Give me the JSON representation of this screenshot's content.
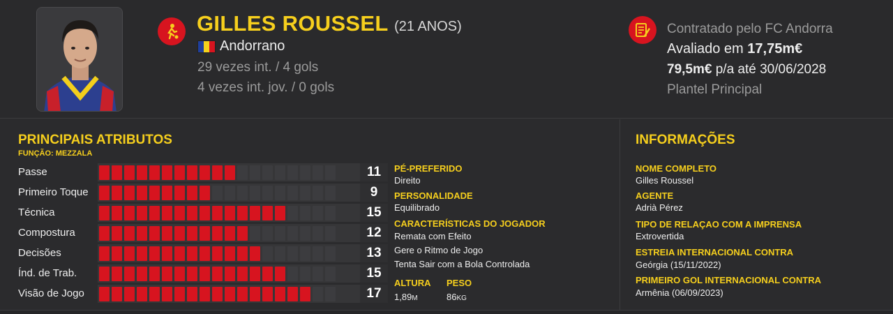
{
  "player": {
    "name": "GILLES ROUSSEL",
    "age": "(21 ANOS)",
    "nationality": "Andorrano",
    "caps": "29 vezes int. / 4 gols",
    "youth_caps": "4 vezes int. jov. / 0 gols"
  },
  "contract": {
    "club": "Contratado pelo FC Andorra",
    "value_prefix": "Avaliado em ",
    "value": "17,75m€",
    "wage": "79,5m€",
    "wage_suffix": " p/a até 30/06/2028",
    "squad": "Plantel Principal"
  },
  "attributes": {
    "title": "PRINCIPAIS ATRIBUTOS",
    "role": "FUNÇÃO: MEZZALA",
    "max": 20,
    "items": [
      {
        "label": "Passe",
        "value": 11
      },
      {
        "label": "Primeiro Toque",
        "value": 9
      },
      {
        "label": "Técnica",
        "value": 15
      },
      {
        "label": "Compostura",
        "value": 12
      },
      {
        "label": "Decisões",
        "value": 13
      },
      {
        "label": "Índ. de Trab.",
        "value": 15
      },
      {
        "label": "Visão de Jogo",
        "value": 17
      }
    ]
  },
  "details": {
    "foot_title": "PÉ-PREFERIDO",
    "foot": "Direito",
    "personality_title": "PERSONALIDADE",
    "personality": "Equilibrado",
    "traits_title": "CARACTERÍSTICAS DO JOGADOR",
    "traits": [
      "Remata com Efeito",
      "Gere o Ritmo de Jogo",
      "Tenta Sair com a Bola Controlada"
    ],
    "height_title": "ALTURA",
    "height": "1,89",
    "height_unit": "M",
    "weight_title": "PESO",
    "weight": "86",
    "weight_unit": "KG"
  },
  "info": {
    "title": "INFORMAÇÕES",
    "full_name_title": "NOME COMPLETO",
    "full_name": "Gilles Roussel",
    "agent_title": "AGENTE",
    "agent": "Adrià Pérez",
    "press_title": "TIPO DE RELAÇAO COM A IMPRENSA",
    "press": "Extrovertida",
    "debut_title": "ESTREIA INTERNACIONAL CONTRA",
    "debut": "Geórgia (15/11/2022)",
    "first_goal_title": "PRIMEIRO GOL INTERNACIONAL CONTRA",
    "first_goal": "Armênia (06/09/2023)"
  },
  "colors": {
    "accent": "#f6cf1d",
    "bar_on": "#d7141f",
    "bar_off": "#3c3c3f",
    "background": "#2b2b2d"
  },
  "icons": {
    "role": "footballer-icon",
    "contract": "contract-document-icon",
    "flag": "andorra-flag-icon"
  }
}
